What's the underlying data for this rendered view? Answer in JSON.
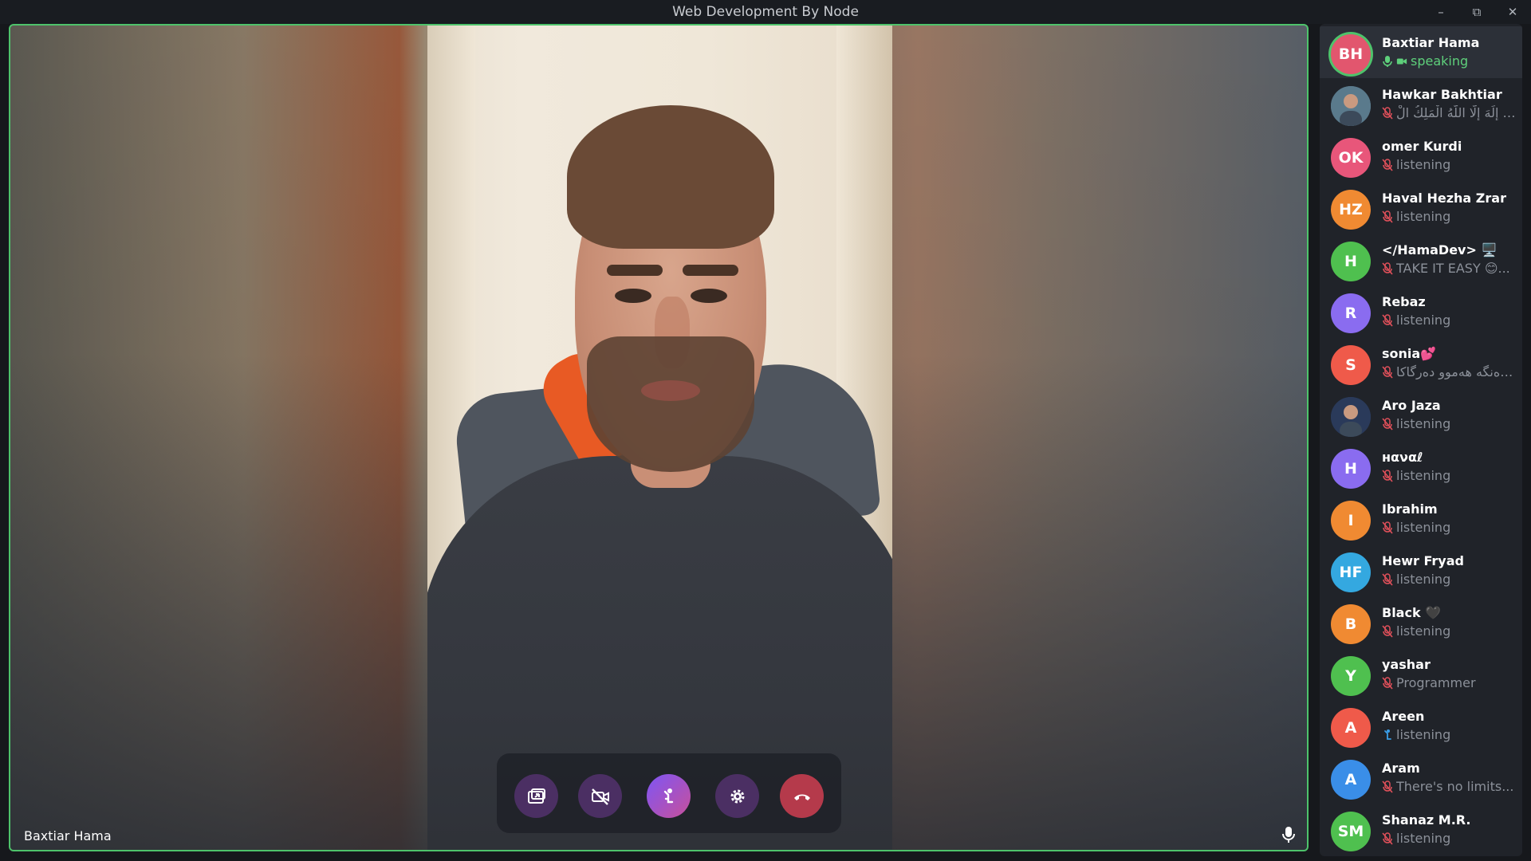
{
  "window": {
    "title": "Web Development By Node",
    "minimize_icon": "minimize-icon",
    "restore_icon": "restore-icon",
    "close_icon": "close-icon"
  },
  "stage": {
    "speaker_name": "Baxtiar Hama",
    "mic_icon": "microphone-icon",
    "accent_color": "#4ec36b"
  },
  "controls": {
    "screen_share_icon": "screen-share-icon",
    "camera_off_icon": "camera-off-icon",
    "raise_hand_icon": "raise-hand-icon",
    "settings_icon": "gear-icon",
    "end_call_icon": "phone-hangup-icon"
  },
  "participants": [
    {
      "initials": "BH",
      "name": "Baxtiar Hama",
      "status": "speaking",
      "color": "#e2566e",
      "state": "speaking"
    },
    {
      "initials": "",
      "name": "Hawkar Bakhtiar",
      "status": "لا إِلَهَ إِلَّا اللَّهُ الْمَلِكُ الْ...",
      "color": "#5a7a8c",
      "state": "muted",
      "photo": true
    },
    {
      "initials": "OK",
      "name": "omer Kurdi",
      "status": "listening",
      "color": "#e8567a",
      "state": "muted"
    },
    {
      "initials": "HZ",
      "name": "Haval Hezha Zrar",
      "status": "listening",
      "color": "#f08a32",
      "state": "muted"
    },
    {
      "initials": "H",
      "name": "</HamaDev> 🖥️",
      "status": "TAKE IT EASY 😊...",
      "color": "#4fc04f",
      "state": "muted"
    },
    {
      "initials": "R",
      "name": "Rebaz",
      "status": "listening",
      "color": "#8a6cf0",
      "state": "muted"
    },
    {
      "initials": "S",
      "name": "sonia💕",
      "status": "ڕەنگە هەموو دەرگاکا...",
      "color": "#ef5a4a",
      "state": "muted"
    },
    {
      "initials": "",
      "name": "Aro Jaza",
      "status": "listening",
      "color": "#2a3a5a",
      "state": "muted",
      "photo": true
    },
    {
      "initials": "H",
      "name": "нαναℓ",
      "status": "listening",
      "color": "#8a6cf0",
      "state": "muted"
    },
    {
      "initials": "I",
      "name": "Ibrahim",
      "status": "listening",
      "color": "#f08a32",
      "state": "muted"
    },
    {
      "initials": "HF",
      "name": "Hewr Fryad",
      "status": "listening",
      "color": "#34a8e0",
      "state": "muted"
    },
    {
      "initials": "B",
      "name": "Black 🖤",
      "status": "listening",
      "color": "#f08a32",
      "state": "muted"
    },
    {
      "initials": "Y",
      "name": "yashar",
      "status": "Programmer",
      "color": "#4fc04f",
      "state": "muted"
    },
    {
      "initials": "A",
      "name": "Areen",
      "status": "listening",
      "color": "#ef5a4a",
      "state": "hand"
    },
    {
      "initials": "A",
      "name": "Aram",
      "status": "There's no limits...",
      "color": "#3a8ee8",
      "state": "muted"
    },
    {
      "initials": "SM",
      "name": "Shanaz M.R.",
      "status": "listening",
      "color": "#4fc04f",
      "state": "muted"
    }
  ]
}
